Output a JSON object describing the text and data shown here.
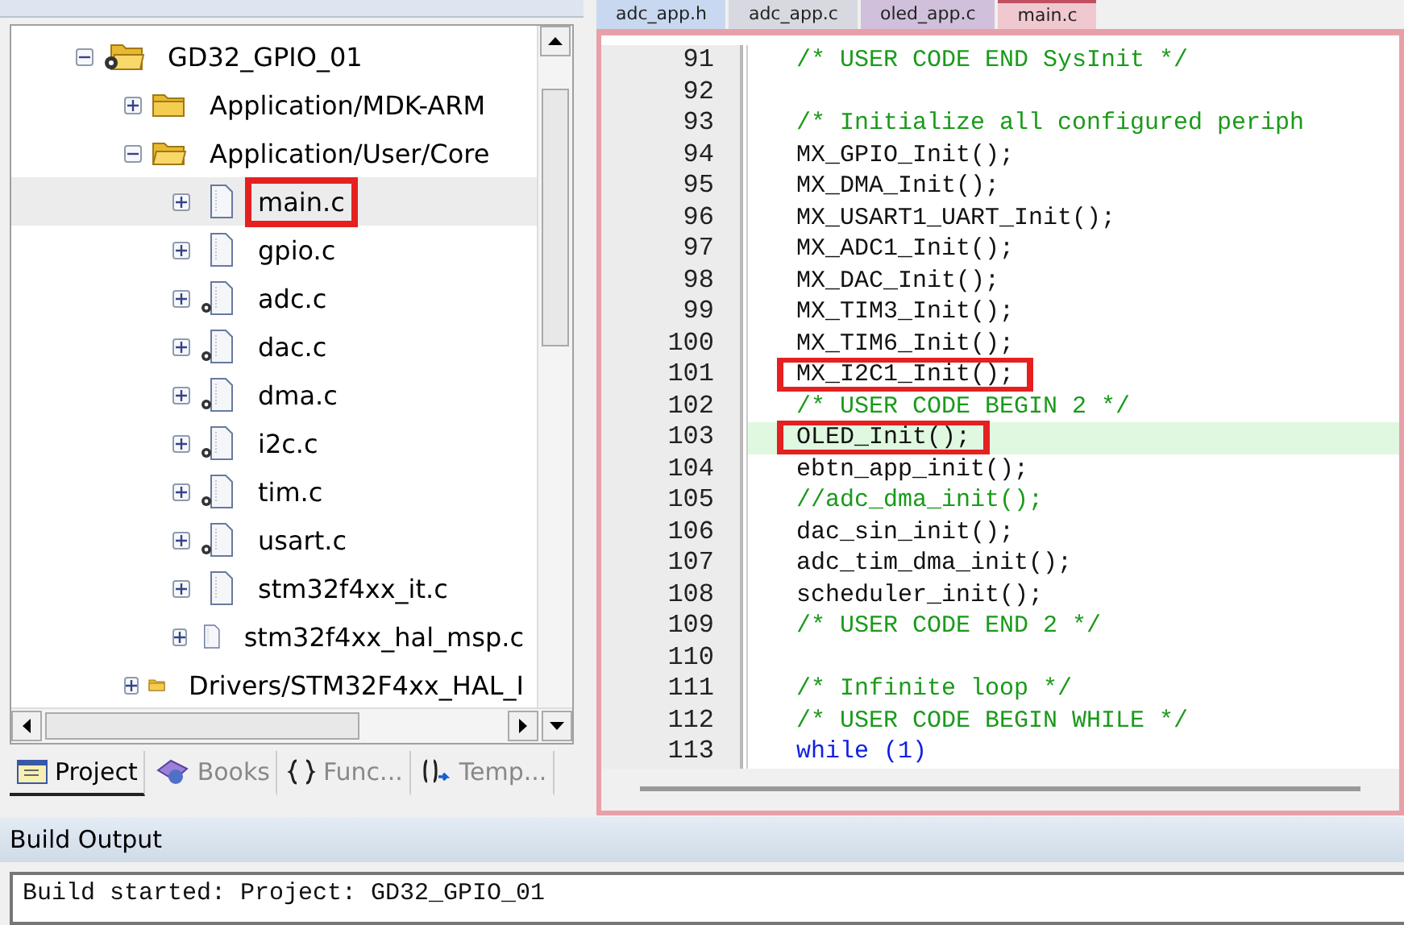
{
  "project_tree": [
    {
      "label": "GD32_GPIO_01",
      "kind": "project",
      "expanded": true,
      "selected": false,
      "annotated": false,
      "children": [
        {
          "label": "Application/MDK-ARM",
          "kind": "folder",
          "expanded": false,
          "selected": false,
          "annotated": false
        },
        {
          "label": "Application/User/Core",
          "kind": "folder",
          "expanded": true,
          "selected": false,
          "annotated": false,
          "children": [
            {
              "label": "main.c",
              "kind": "file",
              "selected": true,
              "annotated": true
            },
            {
              "label": "gpio.c",
              "kind": "file",
              "selected": false,
              "annotated": false
            },
            {
              "label": "adc.c",
              "kind": "generated",
              "selected": false,
              "annotated": false
            },
            {
              "label": "dac.c",
              "kind": "generated",
              "selected": false,
              "annotated": false
            },
            {
              "label": "dma.c",
              "kind": "generated",
              "selected": false,
              "annotated": false
            },
            {
              "label": "i2c.c",
              "kind": "generated",
              "selected": false,
              "annotated": false
            },
            {
              "label": "tim.c",
              "kind": "generated",
              "selected": false,
              "annotated": false
            },
            {
              "label": "usart.c",
              "kind": "generated",
              "selected": false,
              "annotated": false
            },
            {
              "label": "stm32f4xx_it.c",
              "kind": "file",
              "selected": false,
              "annotated": false
            },
            {
              "label": "stm32f4xx_hal_msp.c",
              "kind": "file",
              "selected": false,
              "annotated": false
            }
          ]
        },
        {
          "label": "Drivers/STM32F4xx_HAL_I",
          "kind": "folder",
          "expanded": false,
          "selected": false,
          "annotated": false
        }
      ]
    }
  ],
  "panel_tabs": [
    {
      "label": "Project",
      "kind": "project",
      "selected": true
    },
    {
      "label": "Books",
      "kind": "books",
      "selected": false
    },
    {
      "label": "Func...",
      "kind": "functions",
      "selected": false
    },
    {
      "label": "Temp...",
      "kind": "templates",
      "selected": false
    }
  ],
  "editor_tabs": [
    {
      "label": "adc_app.h",
      "color": "#c8d8f0",
      "selected": false
    },
    {
      "label": "adc_app.c",
      "color": "#d8d8e0",
      "selected": false
    },
    {
      "label": "oled_app.c",
      "color": "#d0c0dc",
      "selected": false
    },
    {
      "label": "main.c",
      "color": "#f0c8d0",
      "selected": true
    }
  ],
  "code_lines": [
    {
      "number": "91",
      "kind": "comment",
      "text": "/* USER CODE END SysInit */",
      "current": false,
      "annotated": false
    },
    {
      "number": "92",
      "current": false,
      "annotated": false
    },
    {
      "number": "93",
      "kind": "comment",
      "text": "/* Initialize all configured periph",
      "current": false,
      "annotated": false
    },
    {
      "number": "94",
      "kind": "code",
      "text": "MX_GPIO_Init();",
      "current": false,
      "annotated": false
    },
    {
      "number": "95",
      "kind": "code",
      "text": "MX_DMA_Init();",
      "current": false,
      "annotated": false
    },
    {
      "number": "96",
      "kind": "code",
      "text": "MX_USART1_UART_Init();",
      "current": false,
      "annotated": false
    },
    {
      "number": "97",
      "kind": "code",
      "text": "MX_ADC1_Init();",
      "current": false,
      "annotated": false
    },
    {
      "number": "98",
      "kind": "code",
      "text": "MX_DAC_Init();",
      "current": false,
      "annotated": false
    },
    {
      "number": "99",
      "kind": "code",
      "text": "MX_TIM3_Init();",
      "current": false,
      "annotated": false
    },
    {
      "number": "100",
      "kind": "code",
      "text": "MX_TIM6_Init();",
      "current": false,
      "annotated": false
    },
    {
      "number": "101",
      "kind": "code",
      "text": "MX_I2C1_Init();",
      "current": false,
      "annotated": true
    },
    {
      "number": "102",
      "kind": "comment",
      "text": "/* USER CODE BEGIN 2 */",
      "current": false,
      "annotated": false
    },
    {
      "number": "103",
      "kind": "code",
      "text": "OLED_Init();",
      "current": true,
      "annotated": true
    },
    {
      "number": "104",
      "kind": "code",
      "text": "ebtn_app_init();",
      "current": false,
      "annotated": false
    },
    {
      "number": "105",
      "kind": "comment",
      "text": "//adc_dma_init();",
      "current": false,
      "annotated": false
    },
    {
      "number": "106",
      "kind": "code",
      "text": "dac_sin_init();",
      "current": false,
      "annotated": false
    },
    {
      "number": "107",
      "kind": "code",
      "text": "adc_tim_dma_init();",
      "current": false,
      "annotated": false
    },
    {
      "number": "108",
      "kind": "code",
      "text": "scheduler_init();",
      "current": false,
      "annotated": false
    },
    {
      "number": "109",
      "kind": "comment",
      "text": "/* USER CODE END 2 */",
      "current": false,
      "annotated": false
    },
    {
      "number": "110",
      "current": false,
      "annotated": false
    },
    {
      "number": "111",
      "kind": "comment",
      "text": "/* Infinite loop */",
      "current": false,
      "annotated": false
    },
    {
      "number": "112",
      "kind": "comment",
      "text": "/* USER CODE BEGIN WHILE */",
      "current": false,
      "annotated": false
    },
    {
      "number": "113",
      "kind": "keyword",
      "text": "while (1)",
      "current": false,
      "annotated": false
    }
  ],
  "build_output": {
    "title": "Build Output",
    "lines": [
      "Build started: Project: GD32_GPIO_01"
    ]
  }
}
